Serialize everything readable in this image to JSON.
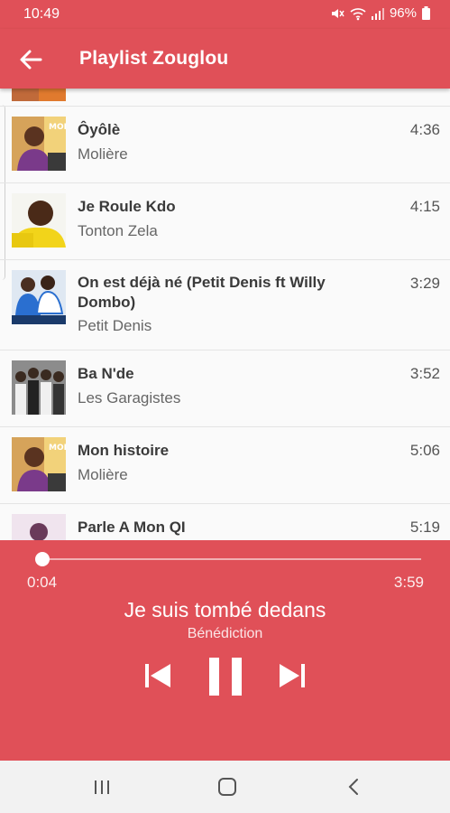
{
  "status_bar": {
    "time": "10:49",
    "battery": "96%"
  },
  "app_bar": {
    "title": "Playlist Zouglou",
    "back_icon": "arrow-left-icon"
  },
  "songs": [
    {
      "title": "Ôyôlè",
      "artist": "Molière",
      "duration": "4:36"
    },
    {
      "title": "Je Roule Kdo",
      "artist": "Tonton Zela",
      "duration": "4:15"
    },
    {
      "title": "On est déjà né (Petit Denis ft Willy Dombo)",
      "artist": "Petit Denis",
      "duration": "3:29"
    },
    {
      "title": "Ba N'de",
      "artist": "Les Garagistes",
      "duration": "3:52"
    },
    {
      "title": "Mon histoire",
      "artist": "Molière",
      "duration": "5:06"
    },
    {
      "title": "Parle A Mon QI",
      "artist": "",
      "duration": "5:19"
    }
  ],
  "player": {
    "current_time": "0:04",
    "total_time": "3:59",
    "progress": 0.017,
    "title": "Je suis tombé dedans",
    "artist": "Bénédiction",
    "icons": {
      "previous": "skip-previous-icon",
      "play_pause": "pause-icon",
      "next": "skip-next-icon"
    }
  },
  "nav_bar": {
    "icons": [
      "recent-apps-icon",
      "home-icon",
      "back-icon"
    ]
  },
  "colors": {
    "accent": "#e05058",
    "nav_bg": "#f2f2f2",
    "list_bg": "#fafafa"
  }
}
